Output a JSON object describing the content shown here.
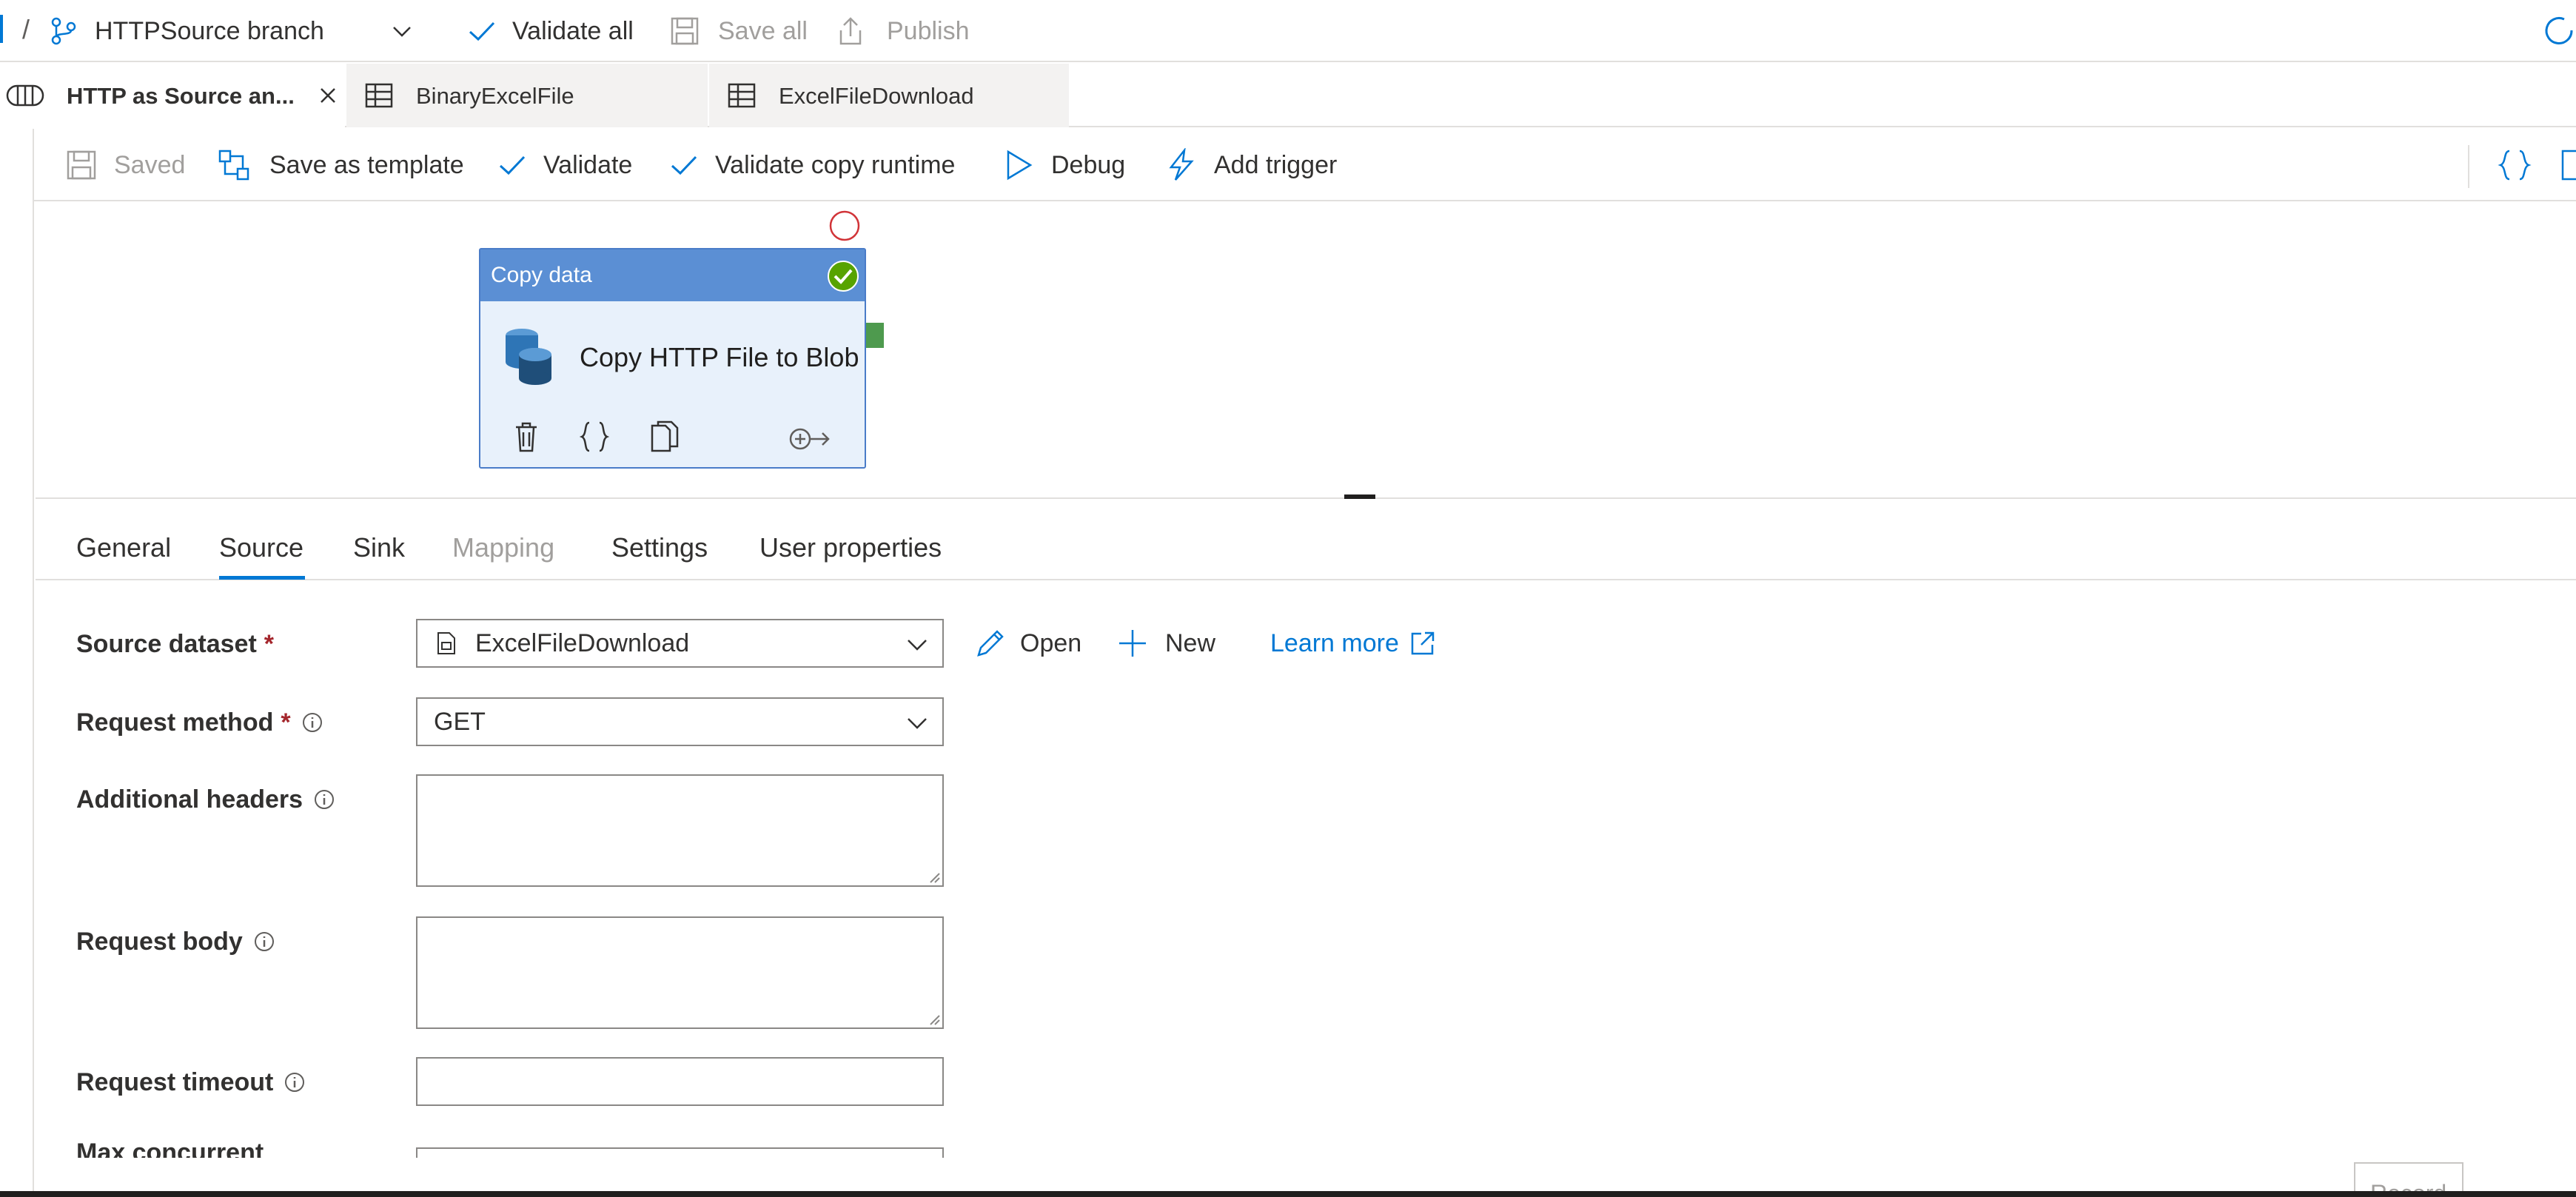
{
  "topbar": {
    "separator": "/",
    "branch": "HTTPSource branch",
    "validate_all": "Validate all",
    "save_all": "Save all",
    "publish": "Publish"
  },
  "tabs": [
    {
      "label": "HTTP as Source an...",
      "active": true
    },
    {
      "label": "BinaryExcelFile",
      "active": false
    },
    {
      "label": "ExcelFileDownload",
      "active": false
    }
  ],
  "toolbar": {
    "saved": "Saved",
    "save_as_template": "Save as template",
    "validate": "Validate",
    "validate_copy_runtime": "Validate copy runtime",
    "debug": "Debug",
    "add_trigger": "Add trigger"
  },
  "activity": {
    "type": "Copy data",
    "name": "Copy HTTP File to Blob",
    "status": "succeeded",
    "header_color": "#5b8fd4",
    "success_color": "#57a300"
  },
  "panel_tabs": [
    {
      "label": "General",
      "state": "normal"
    },
    {
      "label": "Source",
      "state": "selected"
    },
    {
      "label": "Sink",
      "state": "normal"
    },
    {
      "label": "Mapping",
      "state": "disabled"
    },
    {
      "label": "Settings",
      "state": "normal"
    },
    {
      "label": "User properties",
      "state": "normal"
    }
  ],
  "source": {
    "dataset_label": "Source dataset",
    "dataset_value": "ExcelFileDownload",
    "open": "Open",
    "new": "New",
    "learn_more": "Learn more",
    "method_label": "Request method",
    "method_value": "GET",
    "headers_label": "Additional headers",
    "headers_value": "",
    "body_label": "Request body",
    "body_value": "",
    "timeout_label": "Request timeout",
    "timeout_value": "",
    "max_concurrent_label": "Max concurrent",
    "required_mark": "*"
  },
  "footer": {
    "record": "Record"
  },
  "colors": {
    "accent": "#0078d4",
    "required": "#a4262c"
  }
}
